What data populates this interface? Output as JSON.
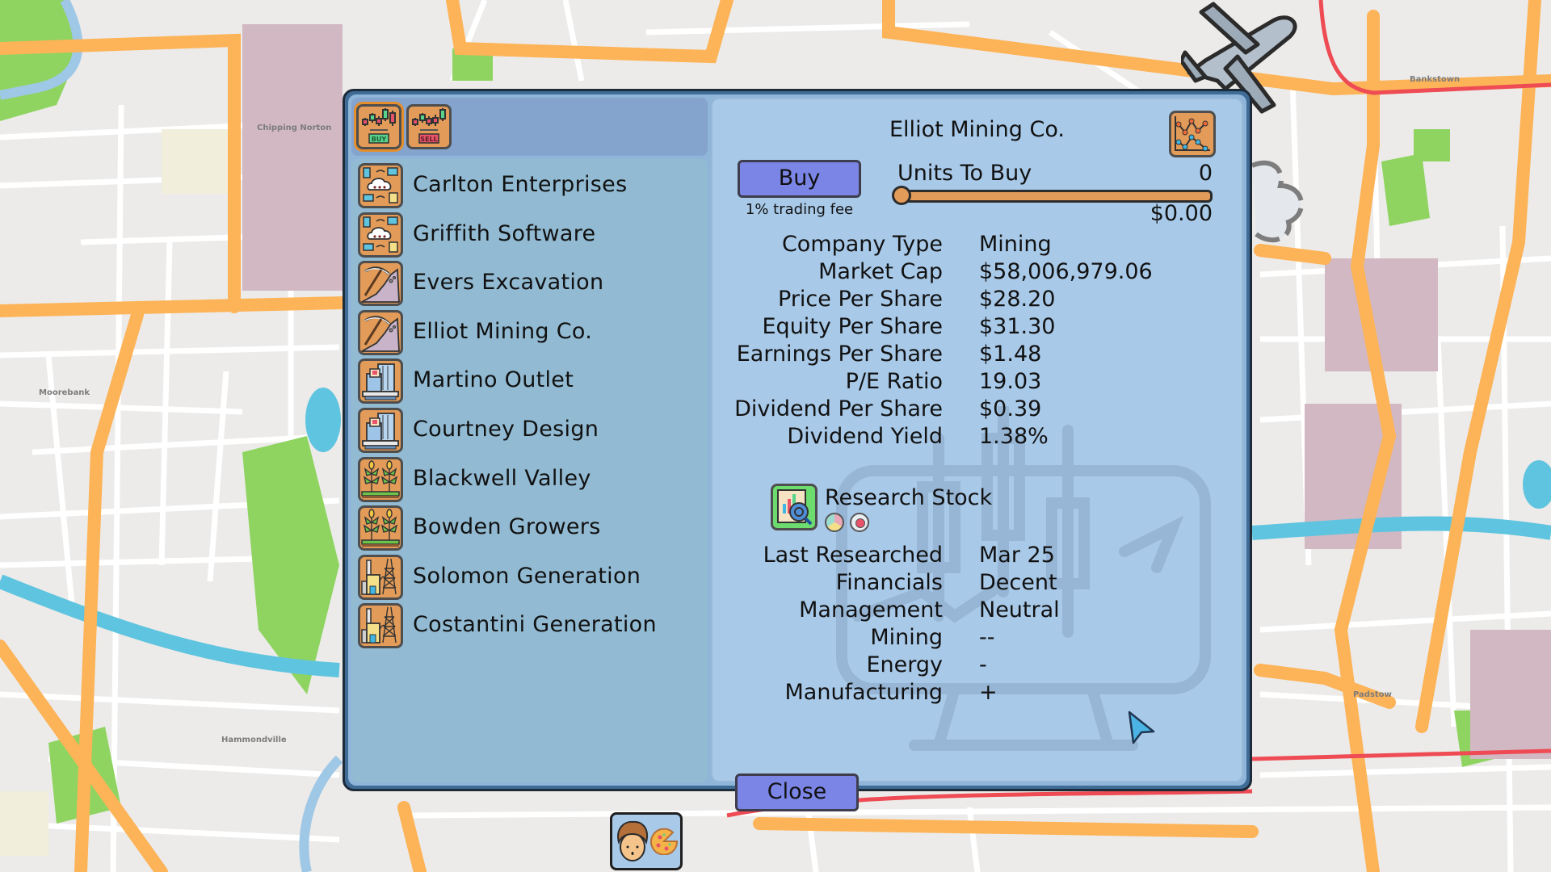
{
  "map": {
    "labels": [
      "Chipping Norton",
      "Moorebank",
      "Hammondville",
      "Bankstown",
      "Padstow"
    ]
  },
  "toolbar": {
    "buy_tab_icon": "stock-buy-icon",
    "buy_tab_label": "BUY",
    "sell_tab_icon": "stock-sell-icon",
    "sell_tab_label": "SELL"
  },
  "companies": [
    {
      "name": "Carlton Enterprises",
      "icon": "cloud-network-icon"
    },
    {
      "name": "Griffith Software",
      "icon": "cloud-network-icon"
    },
    {
      "name": "Evers Excavation",
      "icon": "pickaxe-icon"
    },
    {
      "name": "Elliot Mining Co.",
      "icon": "pickaxe-icon"
    },
    {
      "name": "Martino Outlet",
      "icon": "store-building-icon"
    },
    {
      "name": "Courtney Design",
      "icon": "store-building-icon"
    },
    {
      "name": "Blackwell Valley",
      "icon": "crops-icon"
    },
    {
      "name": "Bowden Growers",
      "icon": "crops-icon"
    },
    {
      "name": "Solomon Generation",
      "icon": "power-plant-icon"
    },
    {
      "name": "Costantini Generation",
      "icon": "power-plant-icon"
    }
  ],
  "detail": {
    "title": "Elliot Mining Co.",
    "chart_button_icon": "line-chart-icon",
    "buy_label": "Buy",
    "fee_note": "1% trading fee",
    "units_label": "Units To Buy",
    "units_value": "0",
    "units_slider_fraction": 0,
    "cost": "$0.00",
    "stats": [
      {
        "label": "Company Type",
        "value": "Mining"
      },
      {
        "label": "Market Cap",
        "value": "$58,006,979.06"
      },
      {
        "label": "Price Per Share",
        "value": "$28.20"
      },
      {
        "label": "Equity Per Share",
        "value": "$31.30"
      },
      {
        "label": "Earnings Per Share",
        "value": "$1.48"
      },
      {
        "label": "P/E Ratio",
        "value": "19.03"
      },
      {
        "label": "Dividend Per Share",
        "value": "$0.39"
      },
      {
        "label": "Dividend Yield",
        "value": "1.38%"
      }
    ],
    "research": {
      "label": "Research Stock",
      "icon": "research-report-icon",
      "cost_icons": [
        "mood-pie-icon",
        "apple-icon"
      ],
      "rows": [
        {
          "label": "Last Researched",
          "value": "Mar 25"
        },
        {
          "label": "Financials",
          "value": "Decent"
        },
        {
          "label": "Management",
          "value": "Neutral"
        },
        {
          "label": "Mining",
          "value": "--"
        },
        {
          "label": "Energy",
          "value": "-"
        },
        {
          "label": "Manufacturing",
          "value": "+"
        }
      ]
    },
    "close_label": "Close"
  },
  "player": {
    "avatar": "curly-hair-face-icon",
    "item": "pizza-icon"
  },
  "colors": {
    "button": "#7b85e6",
    "tile": "#e29b58",
    "panel": "#a8c9e8"
  }
}
